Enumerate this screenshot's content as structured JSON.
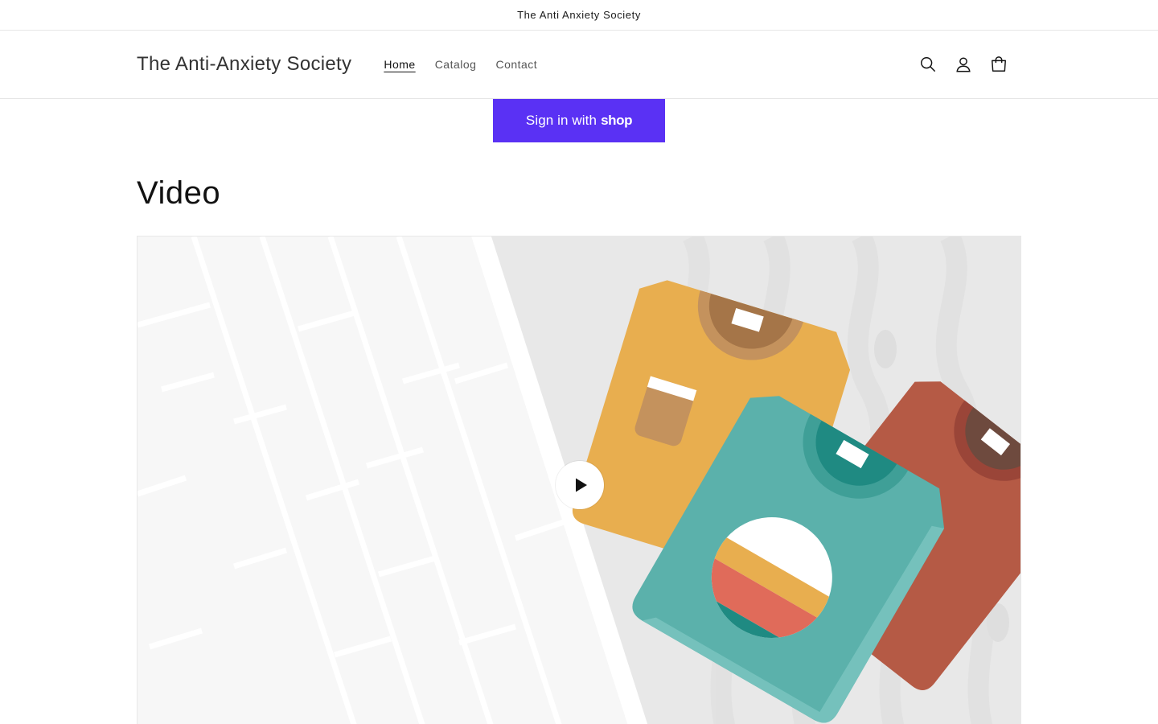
{
  "announcement": {
    "text": "The Anti Anxiety Society"
  },
  "header": {
    "brand": "The Anti-Anxiety Society",
    "nav": [
      {
        "label": "Home",
        "active": true
      },
      {
        "label": "Catalog",
        "active": false
      },
      {
        "label": "Contact",
        "active": false
      }
    ],
    "icons": [
      "search-icon",
      "account-icon",
      "cart-icon"
    ]
  },
  "shop_signin": {
    "label": "Sign in with",
    "brand": "shop",
    "color": "#5a31f4"
  },
  "video_section": {
    "title": "Video",
    "play_icon": "play-icon"
  },
  "colors": {
    "accent": "#5a31f4",
    "text": "#121212",
    "border": "#e6e6e6"
  }
}
